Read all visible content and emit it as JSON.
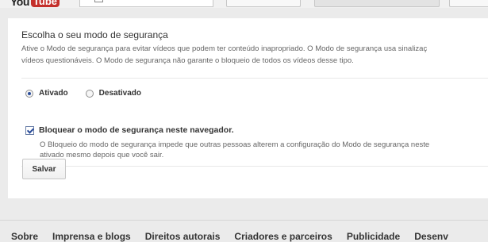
{
  "masthead": {
    "logo_you": "You",
    "logo_tube": "Tube"
  },
  "safety": {
    "title": "Escolha o seu modo de segurança",
    "description_line1": "Ative o Modo de segurança para evitar vídeos que podem ter conteúdo inapropriado. O Modo de segurança usa sinalizaç",
    "description_line2": "vídeos questionáveis. O Modo de segurança não garante o bloqueio de todos os vídeos desse tipo.",
    "option_on": "Ativado",
    "option_off": "Desativado",
    "selected": "Ativado",
    "lock_label": "Bloquear o modo de segurança neste navegador.",
    "lock_checked": true,
    "lock_desc_line1": "O Bloqueio do modo de segurança impede que outras pessoas alterem a configuração do Modo de segurança neste ",
    "lock_desc_line2": "ativado mesmo depois que você sair.",
    "save_label": "Salvar"
  },
  "footer": {
    "links": [
      "Sobre",
      "Imprensa e blogs",
      "Direitos autorais",
      "Criadores e parceiros",
      "Publicidade",
      "Desenv"
    ]
  }
}
